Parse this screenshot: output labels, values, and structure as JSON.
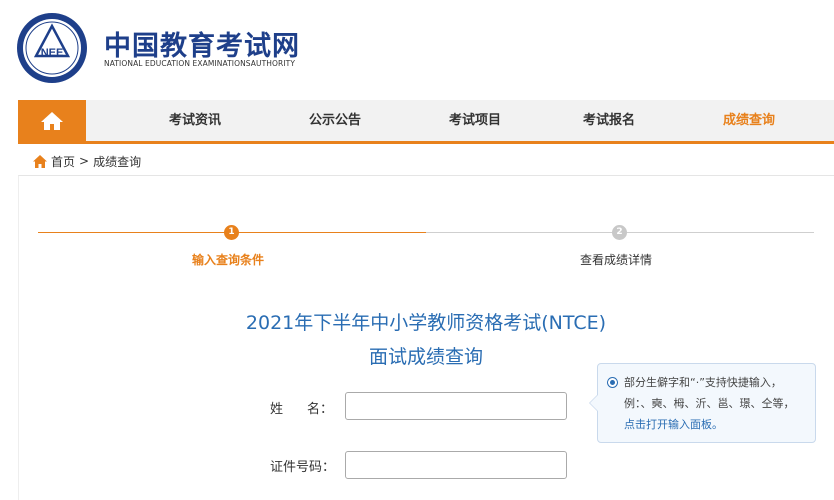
{
  "header": {
    "logo_text": "NEE",
    "brand_cn": "中国教育考试网",
    "brand_en": "NATIONAL EDUCATION EXAMINATIONSAUTHORITY"
  },
  "nav": {
    "home_icon": "home-icon",
    "items": [
      {
        "label": "考试资讯"
      },
      {
        "label": "公示公告"
      },
      {
        "label": "考试项目"
      },
      {
        "label": "考试报名"
      },
      {
        "label": "成绩查询",
        "active": true
      }
    ]
  },
  "breadcrumb": {
    "home": "首页",
    "separator": ">",
    "current": "成绩查询"
  },
  "steps": [
    {
      "number": "1",
      "label": "输入查询条件",
      "active": true
    },
    {
      "number": "2",
      "label": "查看成绩详情",
      "active": false
    }
  ],
  "title": {
    "line1": "2021年下半年中小学教师资格考试(NTCE)",
    "line2": "面试成绩查询"
  },
  "form": {
    "name_label_a": "姓",
    "name_label_b": "名：",
    "name_value": "",
    "id_label": "证件号码：",
    "id_value": ""
  },
  "tooltip": {
    "text": "部分生僻字和“·”支持快捷输入，例：、奭、栂、沂、邕、璟、仝等，",
    "link": "点击打开输入面板。"
  },
  "colors": {
    "accent": "#e8811c",
    "brand": "#1e3f8a",
    "title": "#2a6db3"
  }
}
